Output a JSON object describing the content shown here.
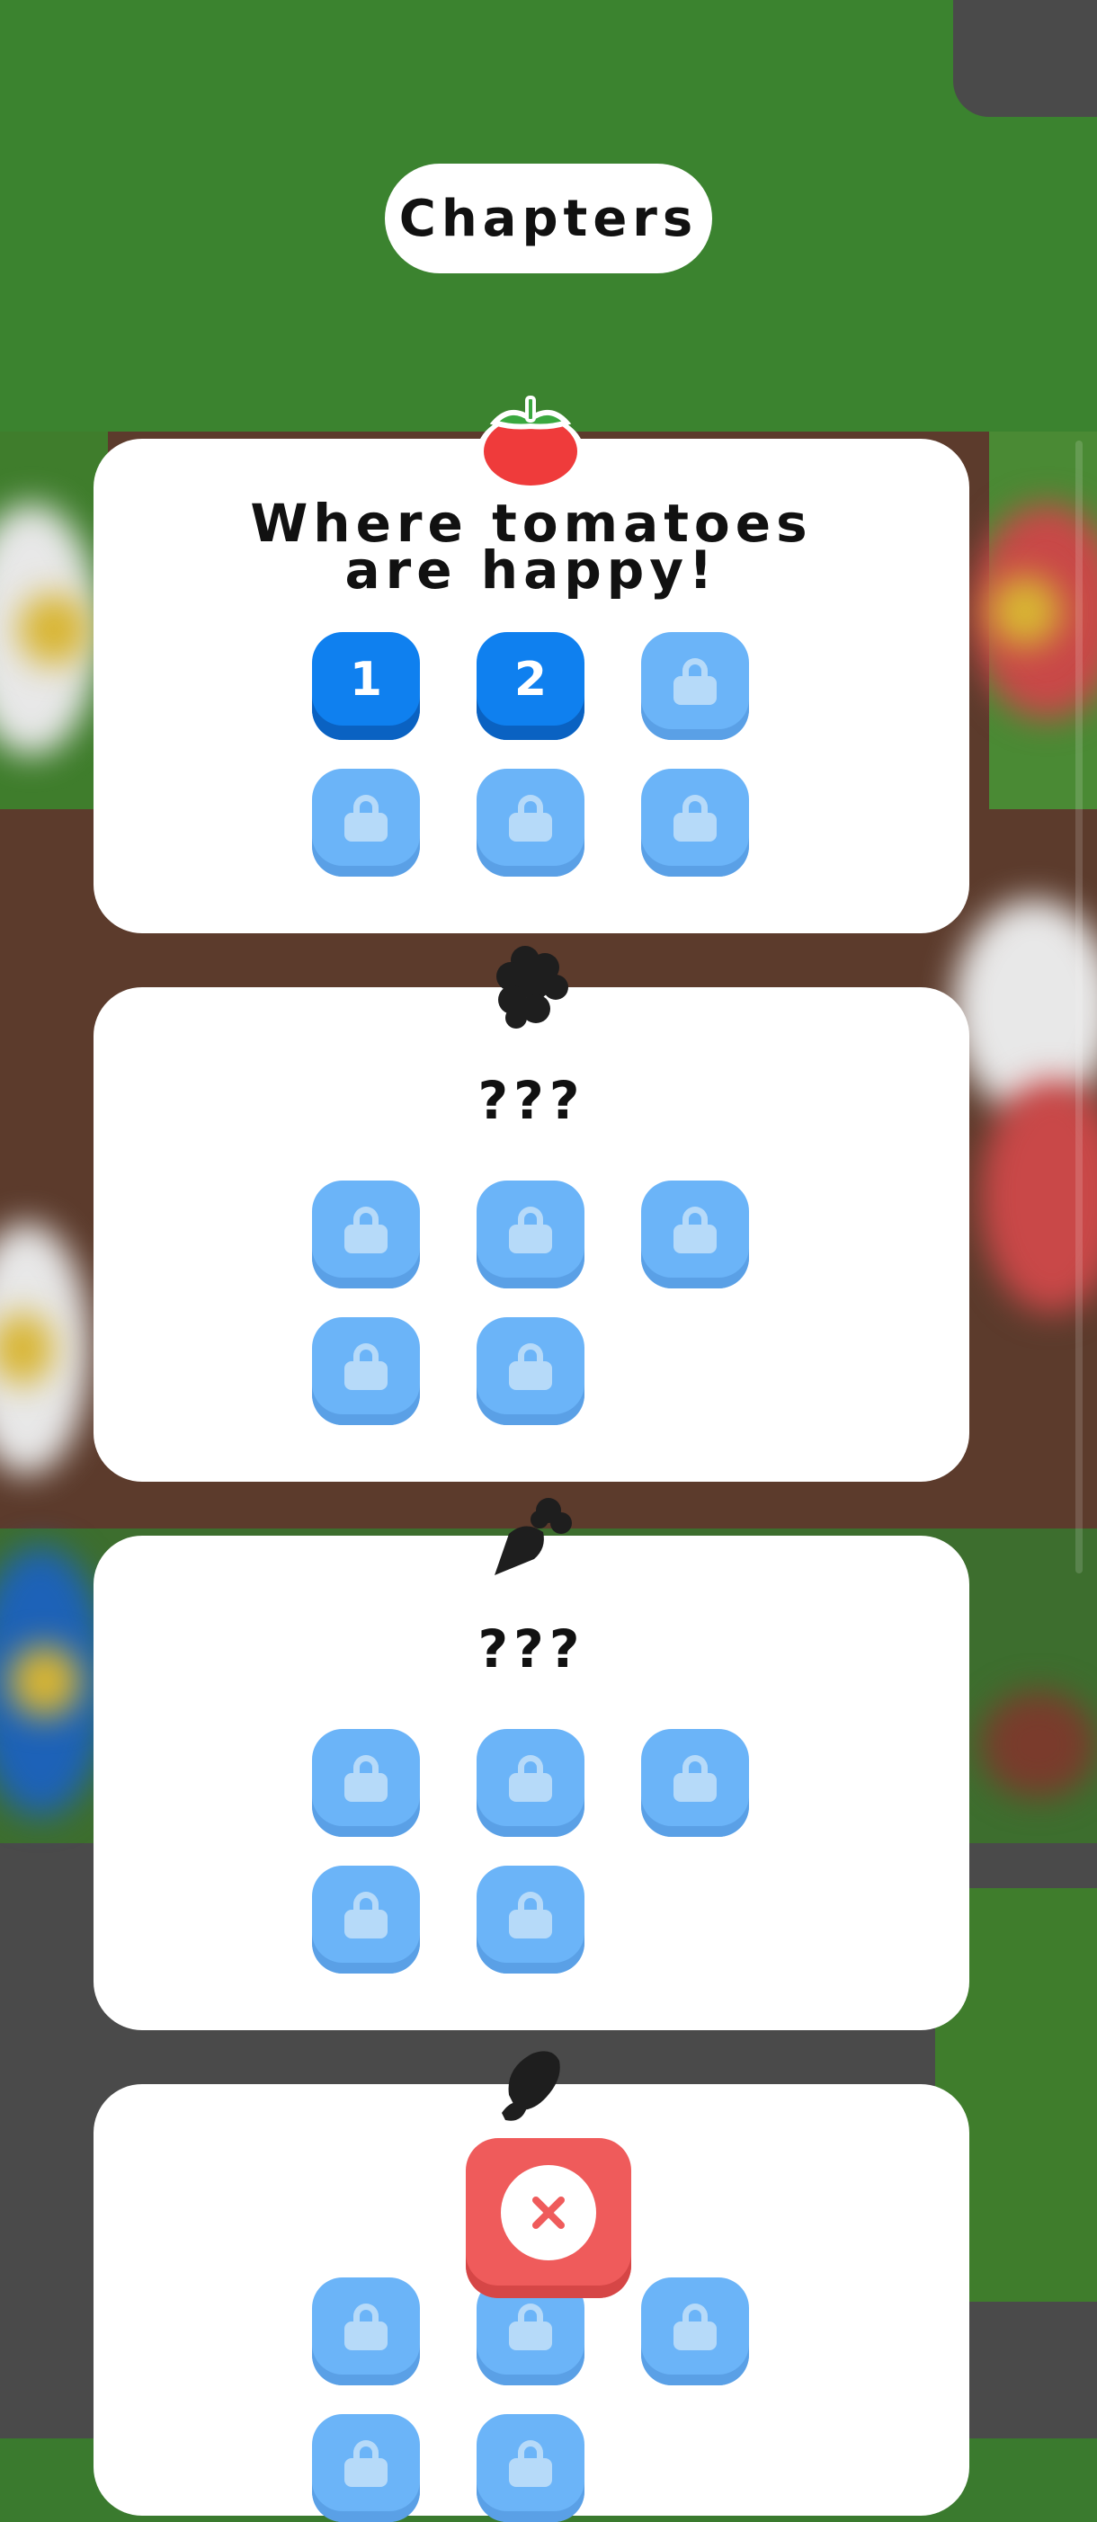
{
  "header": {
    "title": "Chapters"
  },
  "chapters": [
    {
      "title_line1": "Where tomatoes",
      "title_line2": "are happy!",
      "icon": "tomato-icon",
      "levels": [
        {
          "label": "1",
          "locked": false
        },
        {
          "label": "2",
          "locked": false
        },
        {
          "label": "",
          "locked": true
        },
        {
          "label": "",
          "locked": true
        },
        {
          "label": "",
          "locked": true
        },
        {
          "label": "",
          "locked": true
        }
      ]
    },
    {
      "title": "???",
      "icon": "grapes-silhouette-icon",
      "level_count": 5
    },
    {
      "title": "???",
      "icon": "carrot-silhouette-icon",
      "level_count": 5
    },
    {
      "title": "",
      "icon": "corn-silhouette-icon",
      "level_count": 5
    }
  ],
  "close": {
    "icon": "close-icon"
  },
  "colors": {
    "level_open": "#0f80ef",
    "level_locked": "#6bb4f8",
    "close_button": "#ef5b5b",
    "card": "#ffffff"
  }
}
